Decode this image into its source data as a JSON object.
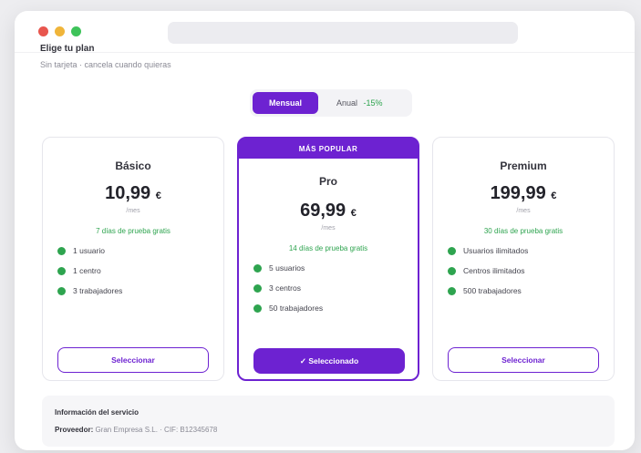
{
  "window": {
    "controls": [
      "close",
      "minimize",
      "maximize"
    ]
  },
  "page": {
    "title": "Elige tu plan",
    "subtitle": "Sin tarjeta · cancela cuando quieras"
  },
  "billing_toggle": {
    "active": "Mensual",
    "inactive": "Anual",
    "saving": "-15%"
  },
  "plans": [
    {
      "name": "Básico",
      "price": "10,99",
      "currency": "€",
      "period": "/mes",
      "trial": "7 días de prueba gratis",
      "features": [
        "1 usuario",
        "1 centro",
        "3 trabajadores"
      ],
      "button": "Seleccionar"
    },
    {
      "badge": "MÁS POPULAR",
      "name": "Pro",
      "price": "69,99",
      "currency": "€",
      "period": "/mes",
      "trial": "14 días de prueba gratis",
      "features": [
        "5 usuarios",
        "3 centros",
        "50 trabajadores"
      ],
      "button": "✓ Seleccionado"
    },
    {
      "name": "Premium",
      "price": "199,99",
      "currency": "€",
      "period": "/mes",
      "trial": "30 días de prueba gratis",
      "features": [
        "Usuarios ilimitados",
        "Centros ilimitados",
        "500 trabajadores"
      ],
      "button": "Seleccionar"
    }
  ],
  "info": {
    "title": "Información del servicio",
    "label": "Proveedor:",
    "value": "Gran Empresa S.L. · CIF: B12345678"
  },
  "colors": {
    "accent": "#6d22d1",
    "success": "#2ea44f"
  }
}
